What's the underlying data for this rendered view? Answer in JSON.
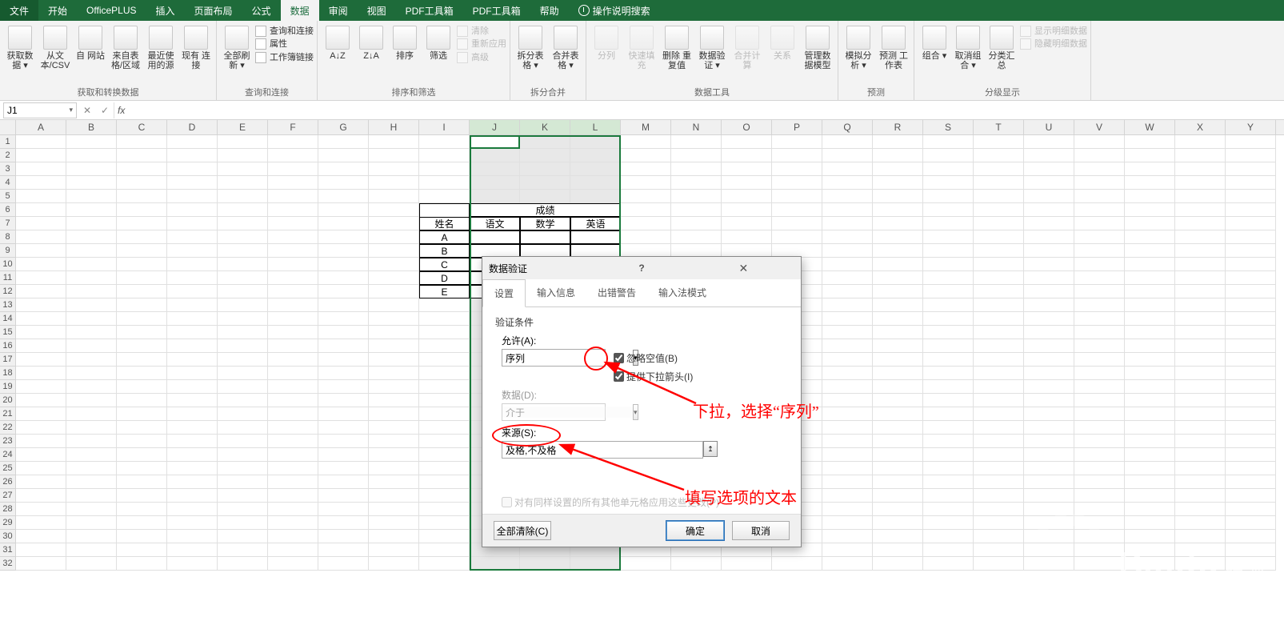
{
  "menu_tabs": {
    "file": "文件",
    "home": "开始",
    "officeplus": "OfficePLUS",
    "insert": "插入",
    "layout": "页面布局",
    "formulas": "公式",
    "data": "数据",
    "review": "审阅",
    "view": "视图",
    "pdf1": "PDF工具箱",
    "pdf2": "PDF工具箱",
    "help": "帮助",
    "tellme": "操作说明搜索"
  },
  "ribbon": {
    "g1": {
      "title": "获取和转换数据",
      "btns": [
        "获取数\n据 ▾",
        "从文\n本/CSV",
        "自\n网站",
        "来自表\n格/区域",
        "最近使\n用的源",
        "现有\n连接"
      ]
    },
    "g2": {
      "title": "查询和连接",
      "big": "全部刷新\n▾",
      "small": [
        "查询和连接",
        "属性",
        "工作簿链接"
      ]
    },
    "g3": {
      "title": "排序和筛选",
      "btns": [
        "A↓Z",
        "Z↓A",
        "排序",
        "筛选"
      ],
      "small": [
        "清除",
        "重新应用",
        "高级"
      ]
    },
    "g4": {
      "title": "拆分合并",
      "btns": [
        "拆分表格\n▾",
        "合并表格\n▾"
      ]
    },
    "g5": {
      "title": "数据工具",
      "btns": [
        "分列",
        "快速填充",
        "删除\n重复值",
        "数据验\n证 ▾",
        "合并计算",
        "关系",
        "管理数\n据模型"
      ]
    },
    "g6": {
      "title": "预测",
      "btns": [
        "模拟分析\n▾",
        "预测\n工作表"
      ]
    },
    "g7": {
      "title": "分级显示",
      "btns": [
        "组合\n▾",
        "取消组合\n▾",
        "分类汇总"
      ],
      "small": [
        "显示明细数据",
        "隐藏明细数据"
      ]
    }
  },
  "formula_bar": {
    "name": "J1",
    "fx_label": "fx",
    "value": ""
  },
  "columns": [
    "A",
    "B",
    "C",
    "D",
    "E",
    "F",
    "G",
    "H",
    "I",
    "J",
    "K",
    "L",
    "M",
    "N",
    "O",
    "P",
    "Q",
    "R",
    "S",
    "T",
    "U",
    "V",
    "W",
    "X",
    "Y"
  ],
  "table": {
    "name_header": "姓名",
    "score_header": "成绩",
    "sub_headers": [
      "语文",
      "数学",
      "英语"
    ],
    "rows": [
      "A",
      "B",
      "C",
      "D",
      "E"
    ]
  },
  "dialog": {
    "title": "数据验证",
    "tabs": [
      "设置",
      "输入信息",
      "出错警告",
      "输入法模式"
    ],
    "criteria_label": "验证条件",
    "allow_label": "允许(A):",
    "allow_value": "序列",
    "ignore_blank": "忽略空值(B)",
    "in_cell_dropdown": "提供下拉箭头(I)",
    "data_label": "数据(D):",
    "data_value": "介于",
    "source_label": "来源(S):",
    "source_value": "及格,不及格",
    "apply_note": "对有同样设置的所有其他单元格应用这些更改(P)",
    "clear_all": "全部清除(C)",
    "ok": "确定",
    "cancel": "取消"
  },
  "annotations": {
    "a1": "下拉，选择“序列”",
    "a2": "填写选项的文本"
  },
  "watermark": {
    "brand": "Baidu",
    "brand_small": "经验",
    "url": "jingyan.baidu.com"
  }
}
